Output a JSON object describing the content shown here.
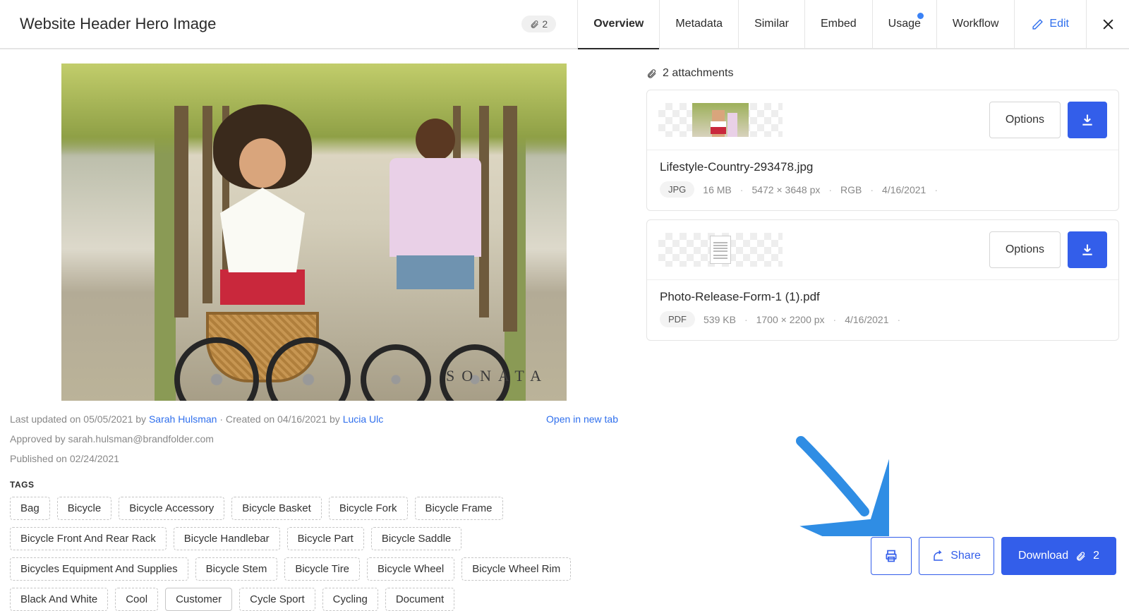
{
  "header": {
    "title": "Website Header Hero Image",
    "attachment_count": "2",
    "tabs": [
      {
        "label": "Overview",
        "active": true
      },
      {
        "label": "Metadata",
        "active": false
      },
      {
        "label": "Similar",
        "active": false
      },
      {
        "label": "Embed",
        "active": false
      },
      {
        "label": "Usage",
        "active": false,
        "dot": true
      },
      {
        "label": "Workflow",
        "active": false
      }
    ],
    "edit_label": "Edit"
  },
  "hero": {
    "watermark": "SONATA"
  },
  "meta": {
    "updated_prefix": "Last updated on 05/05/2021 by ",
    "updated_user": "Sarah Hulsman",
    "created_sep": " · Created on 04/16/2021 by ",
    "created_user": "Lucia Ulc",
    "open_new_tab": "Open in new tab",
    "approved_line": "Approved by sarah.hulsman@brandfolder.com",
    "published_line": "Published on 02/24/2021"
  },
  "tags_heading": "TAGS",
  "tags_row1": [
    "Bag",
    "Bicycle",
    "Bicycle Accessory",
    "Bicycle Basket",
    "Bicycle Fork",
    "Bicycle Frame",
    "Bicycle Front And Rear Rack"
  ],
  "tags_row2": [
    "Bicycle Handlebar",
    "Bicycle Part",
    "Bicycle Saddle",
    "Bicycles Equipment And Supplies",
    "Bicycle Stem",
    "Bicycle Tire"
  ],
  "tags_row3": [
    "Bicycle Wheel",
    "Bicycle Wheel Rim",
    "Black And White",
    "Cool",
    "Customer",
    "Cycle Sport",
    "Cycling",
    "Document"
  ],
  "attachments_header": "2 attachments",
  "attachments": [
    {
      "options_label": "Options",
      "filename": "Lifestyle-Country-293478.jpg",
      "filetype": "JPG",
      "size": "16 MB",
      "dimensions": "5472 × 3648 px",
      "colorspace": "RGB",
      "date": "4/16/2021",
      "thumb": "photo"
    },
    {
      "options_label": "Options",
      "filename": "Photo-Release-Form-1 (1).pdf",
      "filetype": "PDF",
      "size": "539 KB",
      "dimensions": "1700 × 2200 px",
      "colorspace": "",
      "date": "4/16/2021",
      "thumb": "doc"
    }
  ],
  "footer": {
    "share_label": "Share",
    "download_label": "Download",
    "download_count": "2"
  }
}
